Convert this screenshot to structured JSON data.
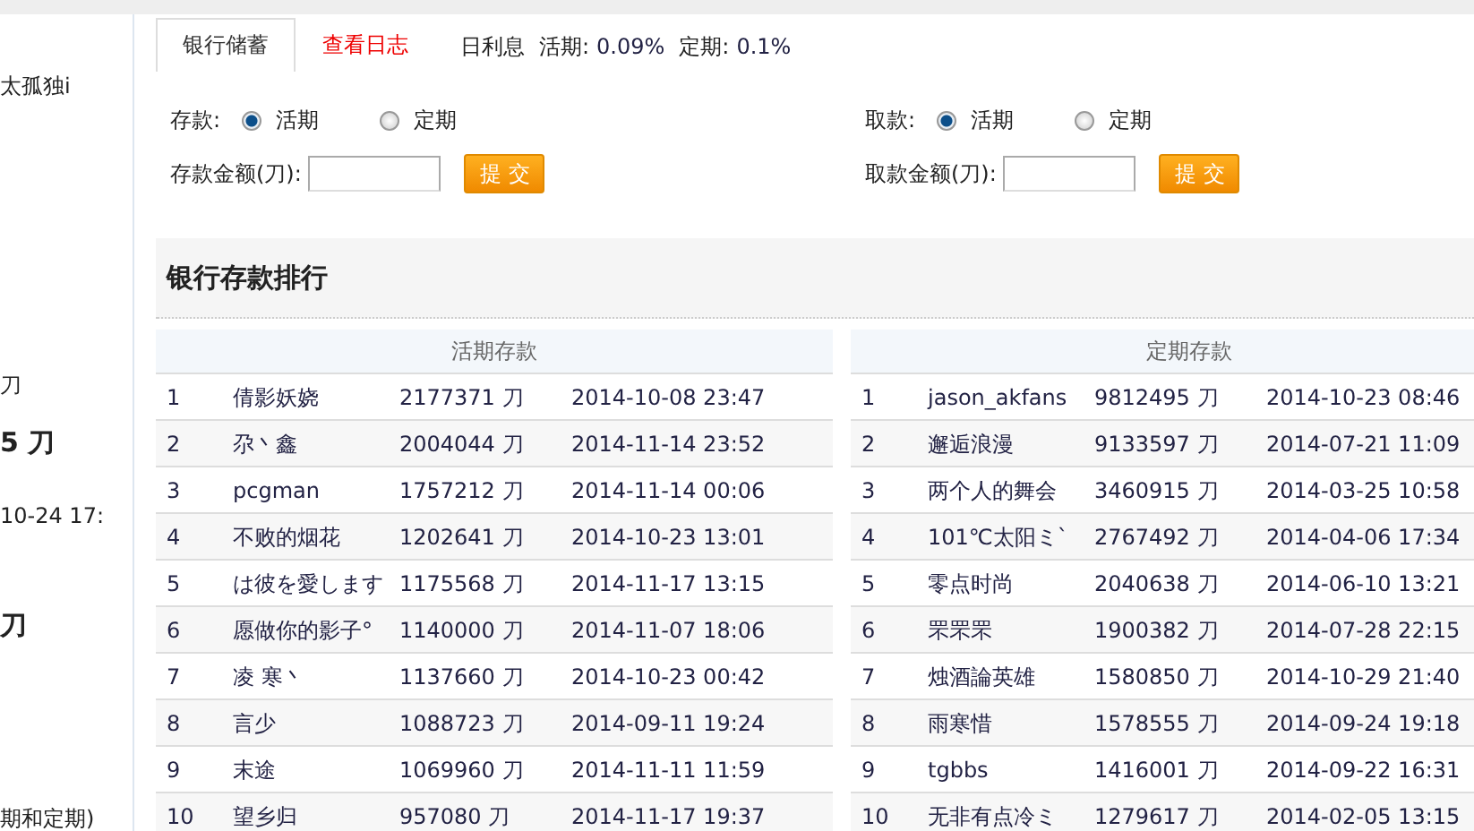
{
  "sidebar": {
    "items": [
      {
        "text": "太孤独i",
        "kind": "normal"
      },
      {
        "text": "刀",
        "kind": "normal"
      },
      {
        "text": "5 刀",
        "kind": "bold"
      },
      {
        "text": "10-24 17:",
        "kind": "normal"
      },
      {
        "text": "刀",
        "kind": "bold"
      },
      {
        "text": "期和定期)",
        "kind": "normal"
      }
    ]
  },
  "tabs": [
    {
      "label": "银行储蓄",
      "selected": true
    },
    {
      "label": "查看日志",
      "selected": false
    }
  ],
  "rates": {
    "label": "日利息",
    "items": [
      {
        "label": "活期:",
        "value": "0.09%"
      },
      {
        "label": "定期:",
        "value": "0.1%"
      }
    ]
  },
  "forms": [
    {
      "label": "存款:",
      "options": [
        {
          "label": "活期",
          "selected": true
        },
        {
          "label": "定期",
          "selected": false
        }
      ],
      "amount_label": "存款金额(刀):",
      "button": "提 交"
    },
    {
      "label": "取款:",
      "options": [
        {
          "label": "活期",
          "selected": true
        },
        {
          "label": "定期",
          "selected": false
        }
      ],
      "amount_label": "取款金额(刀):",
      "button": "提 交"
    }
  ],
  "ranking": {
    "title": "银行存款排行",
    "tables": [
      {
        "heading": "活期存款",
        "rows": [
          [
            "1",
            "倩影妖娆",
            "2177371 刀",
            "2014-10-08 23:47"
          ],
          [
            "2",
            "尕丶鑫",
            "2004044 刀",
            "2014-11-14 23:52"
          ],
          [
            "3",
            "pcgman",
            "1757212 刀",
            "2014-11-14 00:06"
          ],
          [
            "4",
            "不败的烟花",
            "1202641 刀",
            "2014-10-23 13:01"
          ],
          [
            "5",
            "は彼を愛します",
            "1175568 刀",
            "2014-11-17 13:15"
          ],
          [
            "6",
            "愿做你的影子°",
            "1140000 刀",
            "2014-11-07 18:06"
          ],
          [
            "7",
            "凌 寒丶",
            "1137660 刀",
            "2014-10-23 00:42"
          ],
          [
            "8",
            "言少",
            "1088723 刀",
            "2014-09-11 19:24"
          ],
          [
            "9",
            "末途",
            "1069960 刀",
            "2014-11-11 11:59"
          ],
          [
            "10",
            "望乡归",
            "957080 刀",
            "2014-11-17 19:37"
          ]
        ]
      },
      {
        "heading": "定期存款",
        "rows": [
          [
            "1",
            "jason_akfans",
            "9812495 刀",
            "2014-10-23 08:46"
          ],
          [
            "2",
            "邂逅浪漫",
            "9133597 刀",
            "2014-07-21 11:09"
          ],
          [
            "3",
            "两个人的舞会",
            "3460915 刀",
            "2014-03-25 10:58"
          ],
          [
            "4",
            "101℃太阳ミ`",
            "2767492 刀",
            "2014-04-06 17:34"
          ],
          [
            "5",
            "零点时尚",
            "2040638 刀",
            "2014-06-10 13:21"
          ],
          [
            "6",
            "罘罘罘",
            "1900382 刀",
            "2014-07-28 22:15"
          ],
          [
            "7",
            "烛酒論英雄",
            "1580850 刀",
            "2014-10-29 21:40"
          ],
          [
            "8",
            "雨寒惜",
            "1578555 刀",
            "2014-09-24 19:18"
          ],
          [
            "9",
            "tgbbs",
            "1416001 刀",
            "2014-09-22 16:31"
          ],
          [
            "10",
            "无非有点冷ミ",
            "1279617 刀",
            "2014-02-05 13:15"
          ]
        ]
      }
    ]
  }
}
